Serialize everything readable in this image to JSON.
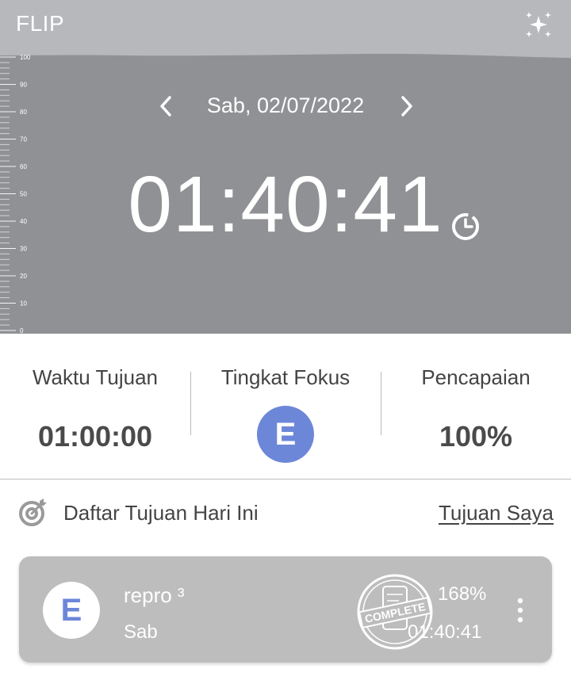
{
  "header": {
    "app_title": "FLIP",
    "date": "Sab, 02/07/2022",
    "timer": "01:40:41",
    "ruler_labels": [
      "100",
      "90",
      "80",
      "70",
      "60",
      "50",
      "40",
      "30",
      "20",
      "10",
      "0"
    ],
    "colors": {
      "background": "#909195",
      "wave": "#b6b8bc"
    }
  },
  "stats": {
    "target_time": {
      "label": "Waktu Tujuan",
      "value": "01:00:00"
    },
    "focus_level": {
      "label": "Tingkat Fokus",
      "value": "E",
      "color": "#6d87d8"
    },
    "achievement": {
      "label": "Pencapaian",
      "value": "100%"
    }
  },
  "goals": {
    "title": "Daftar Tujuan Hari Ini",
    "link": "Tujuan Saya",
    "items": [
      {
        "grade": "E",
        "name": "repro ³",
        "day": "Sab",
        "percent": "168%",
        "time": "01:40:41",
        "stamp": "COMPLETE"
      }
    ]
  },
  "icons": [
    "sparkle-icon",
    "chevron-left-icon",
    "chevron-right-icon",
    "timer-icon",
    "target-icon",
    "more-vertical-icon"
  ]
}
